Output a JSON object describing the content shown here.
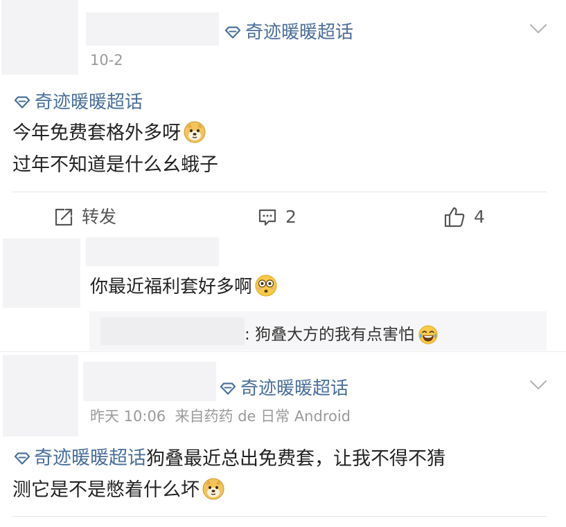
{
  "post1": {
    "topic_tag": "奇迹暖暖超话",
    "date": "10-2",
    "body_topic": "奇迹暖暖超话",
    "body_line1": "今年免费套格外多呀",
    "body_line2": "过年不知道是什么幺蛾子",
    "body_emoji": "doge-emoji",
    "actions": {
      "repost_label": "转发",
      "comment_count": "2",
      "like_count": "4"
    }
  },
  "comment": {
    "text": "你最近福利套好多啊",
    "emoji": "flushed-emoji",
    "reply": {
      "text": ": 狗叠大方的我有点害怕",
      "emoji": "laugh-cry-emoji"
    }
  },
  "post2": {
    "topic_tag": "奇迹暖暖超话",
    "meta": "昨天 10:06  来自药药 de 日常 Android",
    "body_topic": "奇迹暖暖超话",
    "body_line1_rest": "狗叠最近总出免费套，让我不得不猜",
    "body_line2": "测它是不是憋着什么坏",
    "body_emoji": "doge-emoji"
  },
  "colors": {
    "topic_blue": "#4a6f9c",
    "placeholder_gray": "#f3f3f5",
    "meta_gray": "#9a9a9a",
    "doge_yellow": "#f2c45a"
  }
}
